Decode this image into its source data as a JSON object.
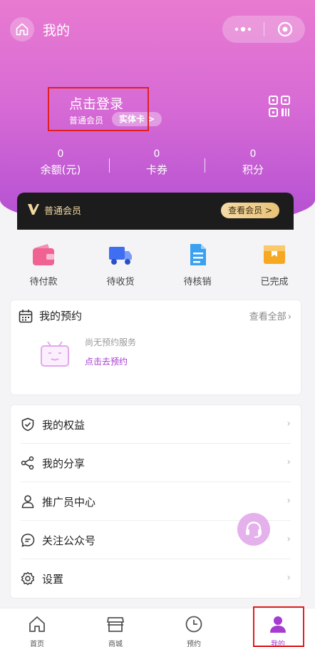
{
  "header": {
    "title": "我的",
    "login_text": "点击登录",
    "member_level": "普通会员",
    "card_tag": "实体卡 >"
  },
  "stats": [
    {
      "value": "0",
      "label": "余额(元)"
    },
    {
      "value": "0",
      "label": "卡券"
    },
    {
      "value": "0",
      "label": "积分"
    }
  ],
  "vip": {
    "label": "普通会员",
    "button": "查看会员 >"
  },
  "orders": [
    {
      "label": "待付款",
      "icon": "wallet-icon",
      "color": "#f06292"
    },
    {
      "label": "待收货",
      "icon": "truck-icon",
      "color": "#3f6ef0"
    },
    {
      "label": "待核销",
      "icon": "document-icon",
      "color": "#3aa0f0"
    },
    {
      "label": "已完成",
      "icon": "box-icon",
      "color": "#f7a823"
    }
  ],
  "appointments": {
    "title": "我的预约",
    "view_all": "查看全部",
    "empty_text": "尚无预约服务",
    "empty_link": "点击去预约"
  },
  "menu": [
    {
      "label": "我的权益",
      "icon": "shield-check-icon"
    },
    {
      "label": "我的分享",
      "icon": "share-icon"
    },
    {
      "label": "推广员中心",
      "icon": "user-icon"
    },
    {
      "label": "关注公众号",
      "icon": "chat-icon"
    },
    {
      "label": "设置",
      "icon": "gear-icon"
    }
  ],
  "tabs": [
    {
      "label": "首页",
      "icon": "home-icon"
    },
    {
      "label": "商城",
      "icon": "shop-icon"
    },
    {
      "label": "预约",
      "icon": "clock-icon"
    },
    {
      "label": "我的",
      "icon": "person-icon"
    }
  ],
  "colors": {
    "accent": "#a53cd0",
    "gradient_top": "#e87ad0",
    "gradient_bottom": "#b24fd2"
  }
}
